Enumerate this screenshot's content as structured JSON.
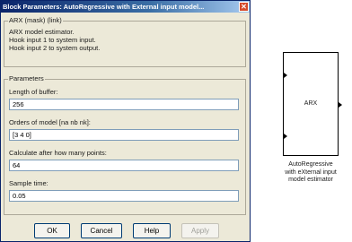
{
  "dialog": {
    "title": "Block Parameters: AutoRegressive with External input model...",
    "close_symbol": "✕",
    "description_group": {
      "legend": "ARX (mask) (link)",
      "lines": [
        "ARX model estimator.",
        "Hook input 1 to system input.",
        "Hook input 2 to system output."
      ]
    },
    "parameters": {
      "legend": "Parameters",
      "fields": [
        {
          "label": "Length of buffer:",
          "value": "256"
        },
        {
          "label": "Orders of model [na nb nk]:",
          "value": "[3 4 0]"
        },
        {
          "label": "Calculate after how many points:",
          "value": "64"
        },
        {
          "label": "Sample time:",
          "value": "0.05"
        }
      ]
    },
    "buttons": {
      "ok": "OK",
      "cancel": "Cancel",
      "help": "Help",
      "apply": "Apply"
    }
  },
  "block": {
    "label": "ARX",
    "caption": [
      "AutoRegressive",
      "with eXternal input",
      "model estimator"
    ]
  }
}
